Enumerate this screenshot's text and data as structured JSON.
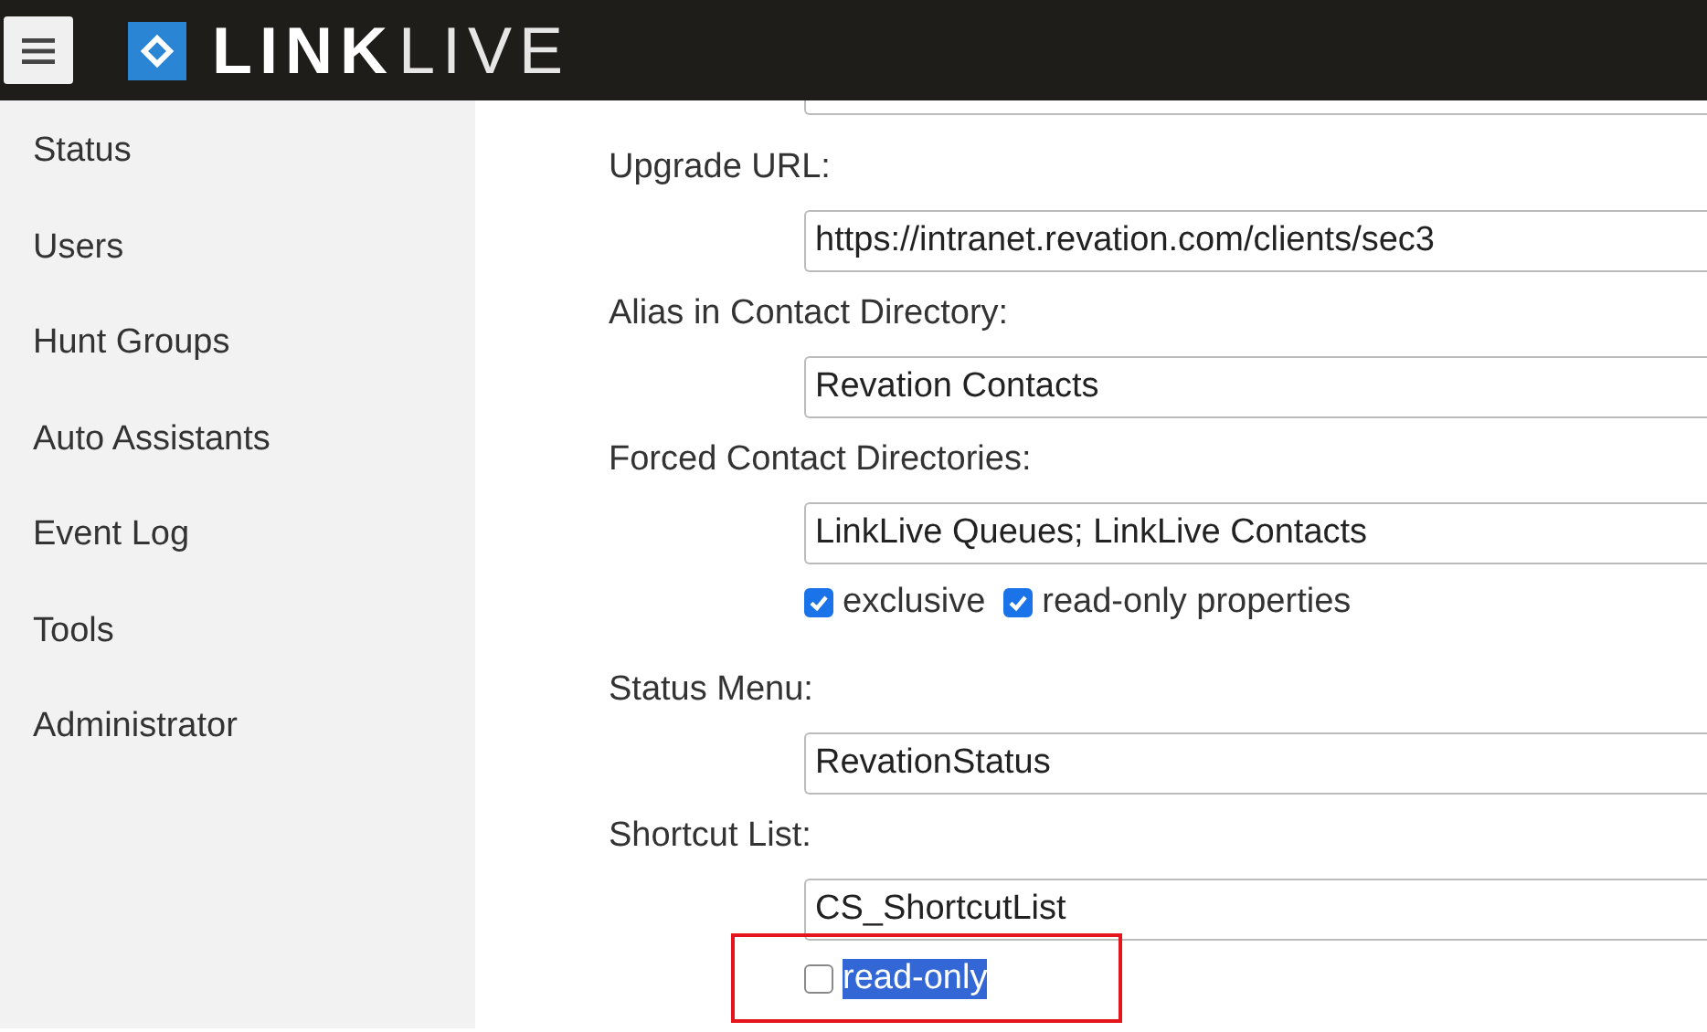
{
  "header": {
    "logo": {
      "bold": "LINK",
      "light": "LIVE"
    }
  },
  "sidebar": {
    "items": [
      {
        "label": "Status"
      },
      {
        "label": "Users"
      },
      {
        "label": "Hunt Groups"
      },
      {
        "label": "Auto Assistants"
      },
      {
        "label": "Event Log"
      },
      {
        "label": "Tools"
      },
      {
        "label": "Administrator"
      }
    ]
  },
  "form": {
    "fields": [
      {
        "label": "Upgrade URL:",
        "value": "https://intranet.revation.com/clients/sec3"
      },
      {
        "label": "Alias in Contact Directory:",
        "value": "Revation Contacts"
      },
      {
        "label": "Forced Contact Directories:",
        "value": "LinkLive Queues; LinkLive Contacts",
        "options": [
          {
            "label": "exclusive",
            "checked": true,
            "text_selected": false
          },
          {
            "label": "read-only properties",
            "checked": true,
            "text_selected": false
          }
        ],
        "highlighted": false
      },
      {
        "label": "Status Menu:",
        "value": "RevationStatus"
      },
      {
        "label": "Shortcut List:",
        "value": "CS_ShortcutList",
        "options": [
          {
            "label": "read-only",
            "checked": false,
            "text_selected": true
          }
        ],
        "highlighted": true
      }
    ]
  }
}
